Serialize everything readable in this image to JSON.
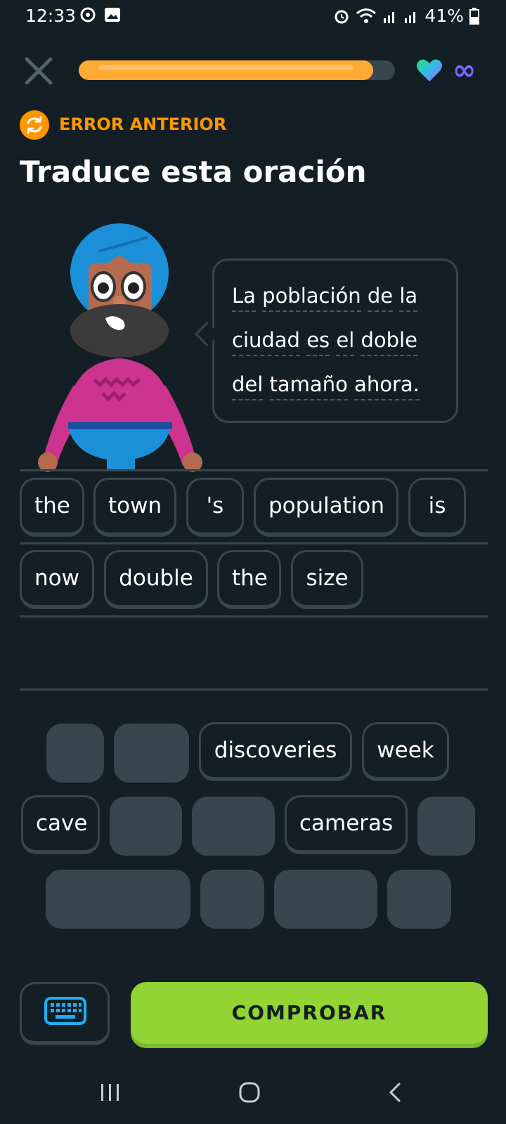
{
  "status_bar": {
    "time": "12:33",
    "battery": "41%"
  },
  "top_bar": {
    "progress_fraction": 0.93,
    "hearts": "∞"
  },
  "header": {
    "previous_error_label": "ERROR ANTERIOR",
    "title": "Traduce esta oración"
  },
  "prompt": {
    "lines": [
      [
        "La",
        "población",
        "de",
        "la"
      ],
      [
        "ciudad",
        "es",
        "el",
        "doble"
      ],
      [
        "del",
        "tamaño",
        "ahora."
      ]
    ]
  },
  "answer_chips": [
    "the",
    "town",
    "'s",
    "population",
    "is",
    "now",
    "double",
    "the",
    "size"
  ],
  "word_bank": {
    "row1": [
      "",
      "",
      "discoveries",
      "week"
    ],
    "row2": [
      "cave",
      "",
      "",
      "cameras",
      ""
    ],
    "row3": [
      "",
      "",
      "",
      ""
    ]
  },
  "buttons": {
    "check": "COMPROBAR"
  },
  "colors": {
    "background": "#131f24",
    "accent_orange": "#ffab33",
    "check_green": "#93d333",
    "chip_border": "#37464f"
  },
  "icons": {
    "close": "close-icon",
    "heart": "heart-icon",
    "keyboard": "keyboard-icon"
  }
}
